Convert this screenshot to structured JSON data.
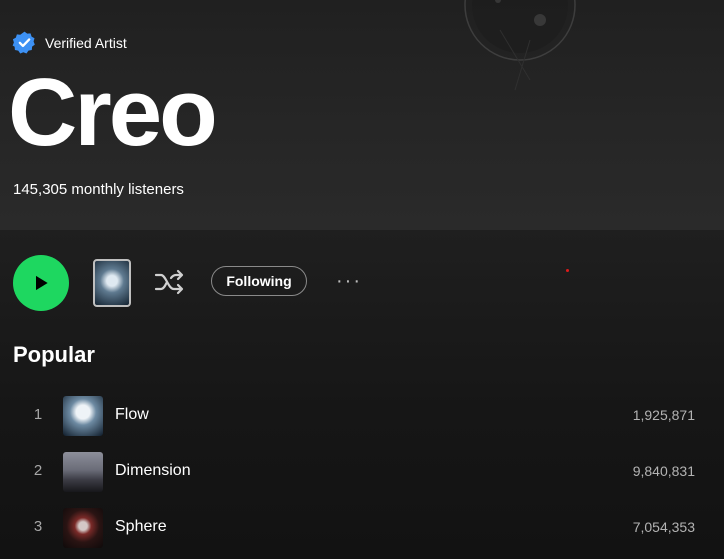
{
  "artist": {
    "verified_label": "Verified Artist",
    "name": "Creo",
    "monthly_listeners": "145,305 monthly listeners"
  },
  "actions": {
    "following_label": "Following",
    "more_label": "···"
  },
  "popular": {
    "title": "Popular",
    "tracks": [
      {
        "rank": "1",
        "title": "Flow",
        "plays": "1,925,871"
      },
      {
        "rank": "2",
        "title": "Dimension",
        "plays": "9,840,831"
      },
      {
        "rank": "3",
        "title": "Sphere",
        "plays": "7,054,353"
      }
    ]
  },
  "colors": {
    "accent_green": "#1ed760",
    "verified_blue": "#3d91f4",
    "background": "#121212"
  },
  "icons": [
    "verified-badge-icon",
    "play-icon",
    "shuffle-icon",
    "more-options-icon"
  ]
}
